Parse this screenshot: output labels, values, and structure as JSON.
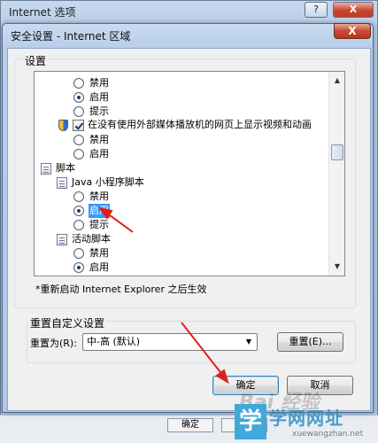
{
  "background_window": {
    "title": "Internet 选项",
    "help_label": "?",
    "close_label": "X",
    "ok_label": "确定",
    "cancel_label": "取消"
  },
  "dialog": {
    "title": "安全设置 - Internet 区域",
    "close_label": "X",
    "settings_legend": "设置",
    "list_rows": [
      {
        "kind": "radio",
        "label": "禁用",
        "checked": false
      },
      {
        "kind": "radio",
        "label": "启用",
        "checked": true
      },
      {
        "kind": "radio",
        "label": "提示",
        "checked": false
      },
      {
        "kind": "checkbox",
        "label": "在没有使用外部媒体播放机的网页上显示视频和动画",
        "checked": true
      },
      {
        "kind": "radio",
        "label": "禁用",
        "checked": false
      },
      {
        "kind": "radio",
        "label": "启用",
        "checked": false
      },
      {
        "kind": "category",
        "label": "脚本"
      },
      {
        "kind": "subcategory",
        "label": "Java 小程序脚本"
      },
      {
        "kind": "radio",
        "label": "禁用",
        "checked": false
      },
      {
        "kind": "radio",
        "label": "启用",
        "checked": true,
        "selected": true
      },
      {
        "kind": "radio",
        "label": "提示",
        "checked": false
      },
      {
        "kind": "subcategory",
        "label": "活动脚本"
      },
      {
        "kind": "radio",
        "label": "禁用",
        "checked": false
      },
      {
        "kind": "radio",
        "label": "启用",
        "checked": true
      }
    ],
    "scrollbar": {
      "up_arrow": "▲",
      "down_arrow": "▼"
    },
    "restart_note": "*重新启动 Internet Explorer 之后生效",
    "reset_legend": "重置自定义设置",
    "reset_label": "重置为(R):",
    "reset_value": "中-高 (默认)",
    "reset_button": "重置(E)...",
    "ok_button": "确定",
    "cancel_button": "取消"
  },
  "watermark": {
    "logo_char": "学",
    "name": "学网网址",
    "url": "xuewangzhan.net",
    "baidu": "Bai 经验"
  },
  "colors": {
    "annotation_arrow": "#e0201b",
    "selection": "#3399ff"
  }
}
